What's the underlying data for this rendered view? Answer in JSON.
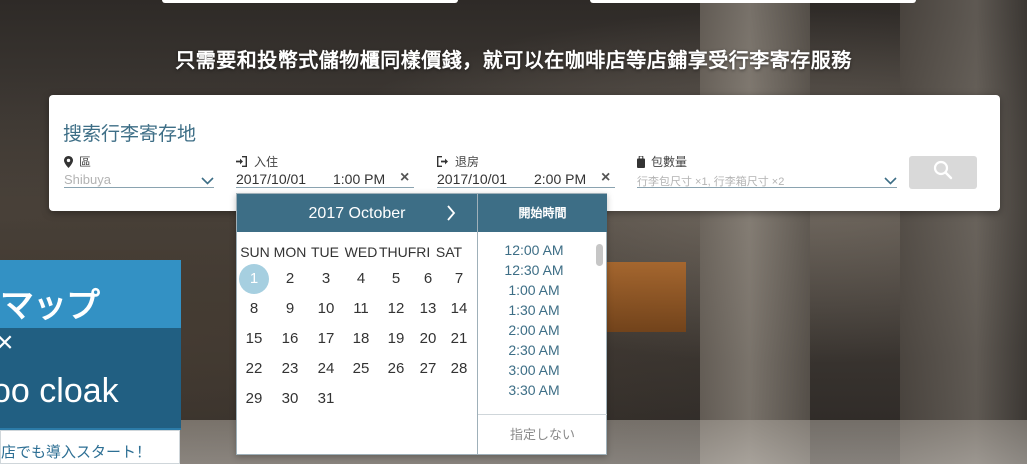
{
  "headline": "只需要和投幣式儲物櫃同樣價錢，就可以在咖啡店等店鋪享受行李寄存服務",
  "ad": {
    "line1": "マップ",
    "line2": "×",
    "line3": "oo cloak",
    "bottom_text": "店でも導入スタート！"
  },
  "search": {
    "title": "搜索行李寄存地",
    "area": {
      "label": "區",
      "placeholder": "Shibuya",
      "icon": "map-pin-icon"
    },
    "checkin": {
      "label": "入住",
      "date": "2017/10/01",
      "time": "1:00 PM",
      "clear": "×",
      "icon": "sign-in-icon"
    },
    "checkout": {
      "label": "退房",
      "date": "2017/10/01",
      "time": "2:00 PM",
      "clear": "×",
      "icon": "sign-out-icon"
    },
    "bags": {
      "label": "包數量",
      "placeholder": "行李包尺寸 ×1, 行李箱尺寸 ×2",
      "icon": "suitcase-icon"
    },
    "search_button_icon": "search-icon"
  },
  "calendar": {
    "month_title": "2017 October",
    "next_icon": "chevron-right-icon",
    "weekdays": [
      "SUN",
      "MON",
      "TUE",
      "WED",
      "THU",
      "FRI",
      "SAT"
    ],
    "selected_day": "1",
    "weeks": [
      [
        "1",
        "2",
        "3",
        "4",
        "5",
        "6",
        "7"
      ],
      [
        "8",
        "9",
        "10",
        "11",
        "12",
        "13",
        "14"
      ],
      [
        "15",
        "16",
        "17",
        "18",
        "19",
        "20",
        "21"
      ],
      [
        "22",
        "23",
        "24",
        "25",
        "26",
        "27",
        "28"
      ],
      [
        "29",
        "30",
        "31"
      ]
    ]
  },
  "time_picker": {
    "title": "開始時間",
    "options": [
      "12:00 AM",
      "12:30 AM",
      "1:00 AM",
      "1:30 AM",
      "2:00 AM",
      "2:30 AM",
      "3:00 AM",
      "3:30 AM"
    ],
    "footer": "指定しない"
  },
  "colors": {
    "accent": "#3d6e86",
    "selected_day": "#a6cfe0",
    "ad_blue": "#2b7ba8"
  }
}
